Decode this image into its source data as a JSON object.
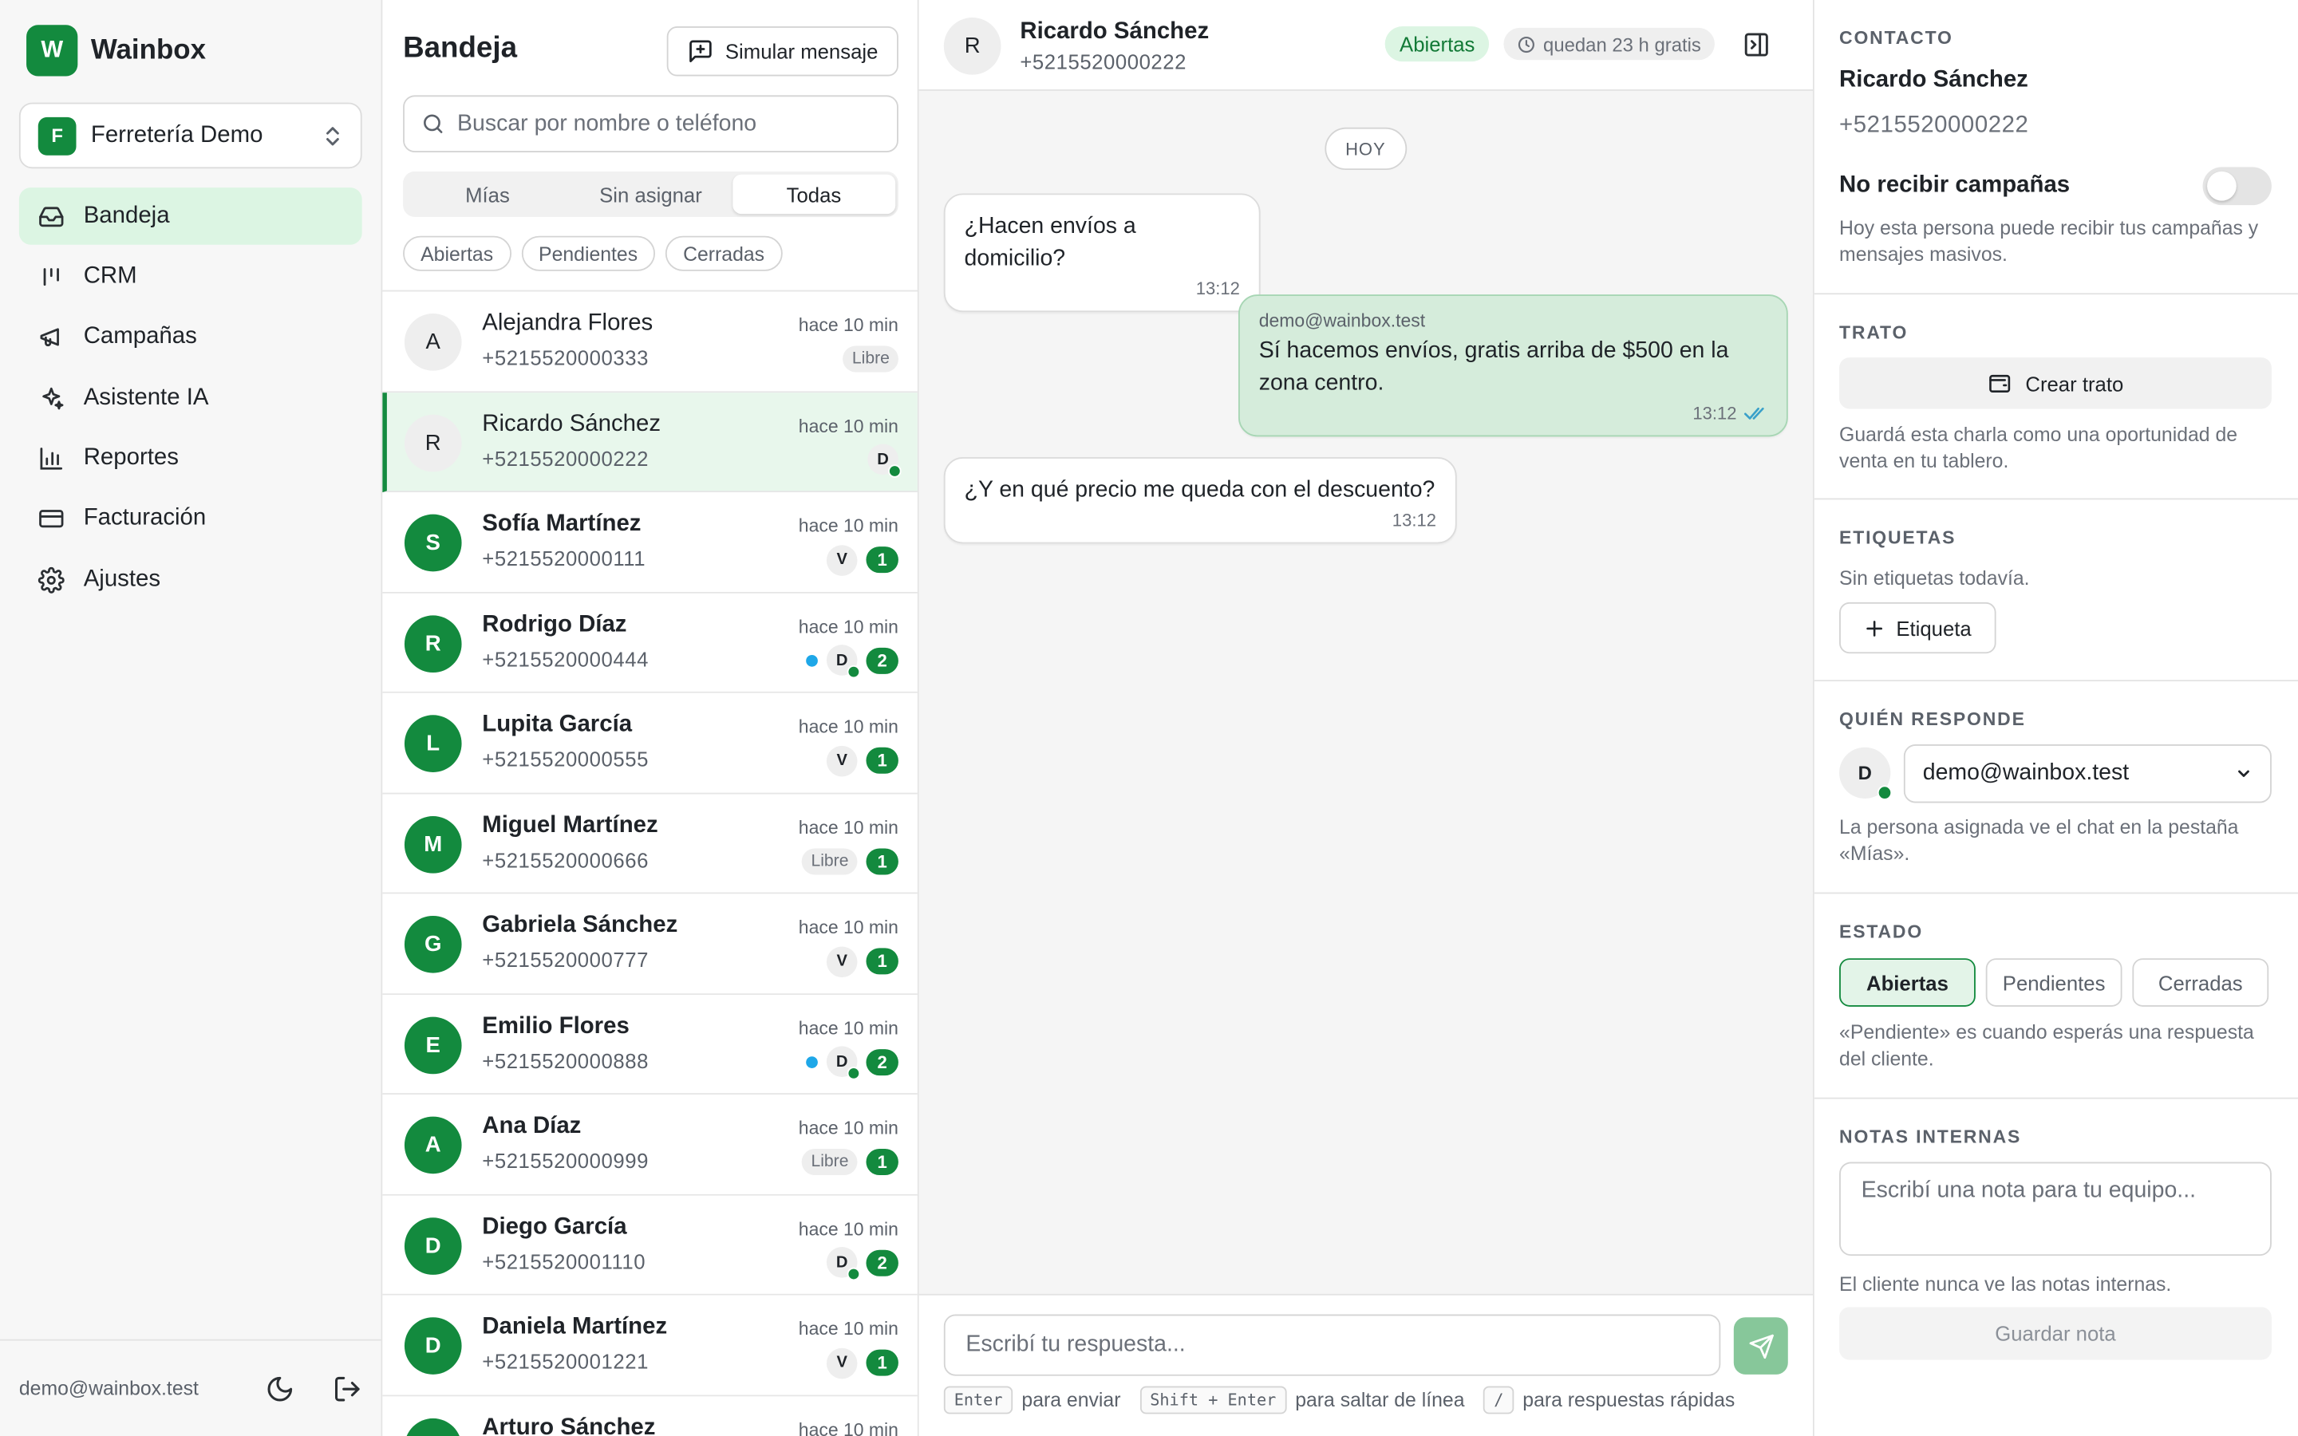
{
  "sidebar": {
    "brand": {
      "logo_letter": "W",
      "name": "Wainbox"
    },
    "org": {
      "badge": "F",
      "name": "Ferretería Demo"
    },
    "nav": [
      {
        "label": "Bandeja",
        "icon": "inbox-icon",
        "active": true
      },
      {
        "label": "CRM",
        "icon": "kanban-icon",
        "active": false
      },
      {
        "label": "Campañas",
        "icon": "megaphone-icon",
        "active": false
      },
      {
        "label": "Asistente IA",
        "icon": "sparkles-icon",
        "active": false
      },
      {
        "label": "Reportes",
        "icon": "bar-chart-icon",
        "active": false
      },
      {
        "label": "Facturación",
        "icon": "credit-card-icon",
        "active": false
      },
      {
        "label": "Ajustes",
        "icon": "gear-icon",
        "active": false
      }
    ],
    "footer": {
      "email": "demo@wainbox.test",
      "theme_icon": "moon-icon",
      "logout_icon": "logout-icon"
    }
  },
  "inbox": {
    "title": "Bandeja",
    "simulate_label": "Simular mensaje",
    "search_placeholder": "Buscar por nombre o teléfono",
    "segments": [
      {
        "label": "Mías",
        "active": false
      },
      {
        "label": "Sin asignar",
        "active": false
      },
      {
        "label": "Todas",
        "active": true
      }
    ],
    "status_filters": [
      "Abiertas",
      "Pendientes",
      "Cerradas"
    ],
    "conversations": [
      {
        "initial": "A",
        "name": "Alejandra Flores",
        "phone": "+5215520000333",
        "time": "hace 10 min",
        "free": "Libre",
        "agent": "",
        "unread": "",
        "blue": false,
        "bold": false,
        "grey": true,
        "selected": false
      },
      {
        "initial": "R",
        "name": "Ricardo Sánchez",
        "phone": "+5215520000222",
        "time": "hace 10 min",
        "free": "",
        "agent": "D",
        "unread": "",
        "blue": false,
        "bold": false,
        "grey": true,
        "selected": true
      },
      {
        "initial": "S",
        "name": "Sofía Martínez",
        "phone": "+5215520000111",
        "time": "hace 10 min",
        "free": "",
        "agent": "V",
        "unread": "1",
        "blue": false,
        "bold": true,
        "grey": false,
        "selected": false
      },
      {
        "initial": "R",
        "name": "Rodrigo Díaz",
        "phone": "+5215520000444",
        "time": "hace 10 min",
        "free": "",
        "agent": "D",
        "unread": "2",
        "blue": true,
        "bold": true,
        "grey": false,
        "selected": false
      },
      {
        "initial": "L",
        "name": "Lupita García",
        "phone": "+5215520000555",
        "time": "hace 10 min",
        "free": "",
        "agent": "V",
        "unread": "1",
        "blue": false,
        "bold": true,
        "grey": false,
        "selected": false
      },
      {
        "initial": "M",
        "name": "Miguel Martínez",
        "phone": "+5215520000666",
        "time": "hace 10 min",
        "free": "Libre",
        "agent": "",
        "unread": "1",
        "blue": false,
        "bold": true,
        "grey": false,
        "selected": false
      },
      {
        "initial": "G",
        "name": "Gabriela Sánchez",
        "phone": "+5215520000777",
        "time": "hace 10 min",
        "free": "",
        "agent": "V",
        "unread": "1",
        "blue": false,
        "bold": true,
        "grey": false,
        "selected": false
      },
      {
        "initial": "E",
        "name": "Emilio Flores",
        "phone": "+5215520000888",
        "time": "hace 10 min",
        "free": "",
        "agent": "D",
        "unread": "2",
        "blue": true,
        "bold": true,
        "grey": false,
        "selected": false
      },
      {
        "initial": "A",
        "name": "Ana Díaz",
        "phone": "+5215520000999",
        "time": "hace 10 min",
        "free": "Libre",
        "agent": "",
        "unread": "1",
        "blue": false,
        "bold": true,
        "grey": false,
        "selected": false
      },
      {
        "initial": "D",
        "name": "Diego García",
        "phone": "+5215520001110",
        "time": "hace 10 min",
        "free": "",
        "agent": "D",
        "unread": "2",
        "blue": false,
        "bold": true,
        "grey": false,
        "selected": false
      },
      {
        "initial": "D",
        "name": "Daniela Martínez",
        "phone": "+5215520001221",
        "time": "hace 10 min",
        "free": "",
        "agent": "V",
        "unread": "1",
        "blue": false,
        "bold": true,
        "grey": false,
        "selected": false
      },
      {
        "initial": "A",
        "name": "Arturo Sánchez",
        "phone": "",
        "time": "hace 10 min",
        "free": "",
        "agent": "",
        "unread": "",
        "blue": false,
        "bold": true,
        "grey": false,
        "selected": false
      }
    ]
  },
  "chat": {
    "contact_initial": "R",
    "contact_name": "Ricardo Sánchez",
    "contact_phone": "+5215520000222",
    "status": "Abiertas",
    "hours_left": "quedan 23 h gratis",
    "day_separator": "HOY",
    "messages": [
      {
        "text": "¿Hacen envíos a domicilio?",
        "time": "13:12"
      },
      {
        "author": "demo@wainbox.test",
        "text": "Sí hacemos envíos, gratis arriba de $500 en la zona centro.",
        "time": "13:12"
      },
      {
        "text": "¿Y en qué precio me queda con el descuento?",
        "time": "13:12"
      }
    ],
    "composer_placeholder": "Escribí tu respuesta...",
    "hints": [
      {
        "key": "Enter",
        "text": "para enviar"
      },
      {
        "key": "Shift + Enter",
        "text": "para saltar de línea"
      },
      {
        "key": "/",
        "text": "para respuestas rápidas"
      }
    ]
  },
  "details": {
    "contact": {
      "label": "CONTACTO",
      "name": "Ricardo Sánchez",
      "phone": "+5215520000222",
      "campaigns_label": "No recibir campañas",
      "campaigns_help": "Hoy esta persona puede recibir tus campañas y mensajes masivos."
    },
    "deal": {
      "label": "TRATO",
      "button": "Crear trato",
      "help": "Guardá esta charla como una oportunidad de venta en tu tablero."
    },
    "tags": {
      "label": "ETIQUETAS",
      "empty": "Sin etiquetas todavía.",
      "button": "Etiqueta"
    },
    "responder": {
      "label": "QUIÉN RESPONDE",
      "avatar": "D",
      "selected": "demo@wainbox.test",
      "help": "La persona asignada ve el chat en la pestaña «Mías»."
    },
    "state": {
      "label": "ESTADO",
      "options": [
        "Abiertas",
        "Pendientes",
        "Cerradas"
      ],
      "help": "«Pendiente» es cuando esperás una respuesta del cliente."
    },
    "notes": {
      "label": "NOTAS INTERNAS",
      "placeholder": "Escribí una nota para tu equipo...",
      "help": "El cliente nunca ve las notas internas.",
      "button": "Guardar nota"
    }
  },
  "colors": {
    "brand": "#138a3e",
    "active_bg": "#dcf5e3",
    "outgoing_bubble": "#d5ecdb"
  }
}
